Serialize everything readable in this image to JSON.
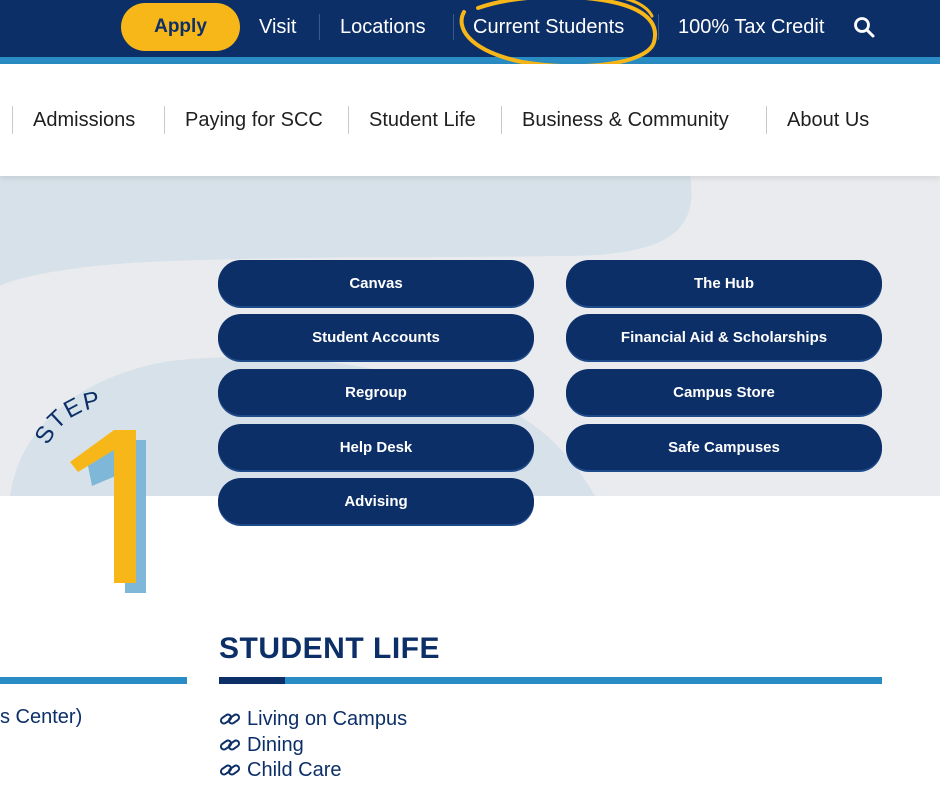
{
  "utility_nav": {
    "apply_label": "Apply",
    "links": [
      "Visit",
      "Locations",
      "Current Students",
      "100% Tax Credit"
    ],
    "search_icon": "search-icon"
  },
  "main_nav": {
    "items": [
      "Admissions",
      "Paying for SCC",
      "Student Life",
      "Business & Community",
      "About Us"
    ]
  },
  "quick_links": {
    "left": [
      "Canvas",
      "Student Accounts",
      "Regroup",
      "Help Desk",
      "Advising"
    ],
    "right": [
      "The Hub",
      "Financial Aid & Scholarships",
      "Campus Store",
      "Safe Campuses"
    ]
  },
  "step_badge": {
    "word": "STEP",
    "number": "1"
  },
  "left_section": {
    "partial_text": "s Center)"
  },
  "student_life": {
    "title": "STUDENT LIFE",
    "links": [
      "Living on Campus",
      "Dining",
      "Child Care"
    ],
    "link_icon": "link-icon"
  },
  "colors": {
    "navy": "#0d2f68",
    "blue": "#2a8cc4",
    "gold": "#f7b718",
    "hero_bg": "#e9ebee",
    "blob": "#d7e1e9"
  }
}
